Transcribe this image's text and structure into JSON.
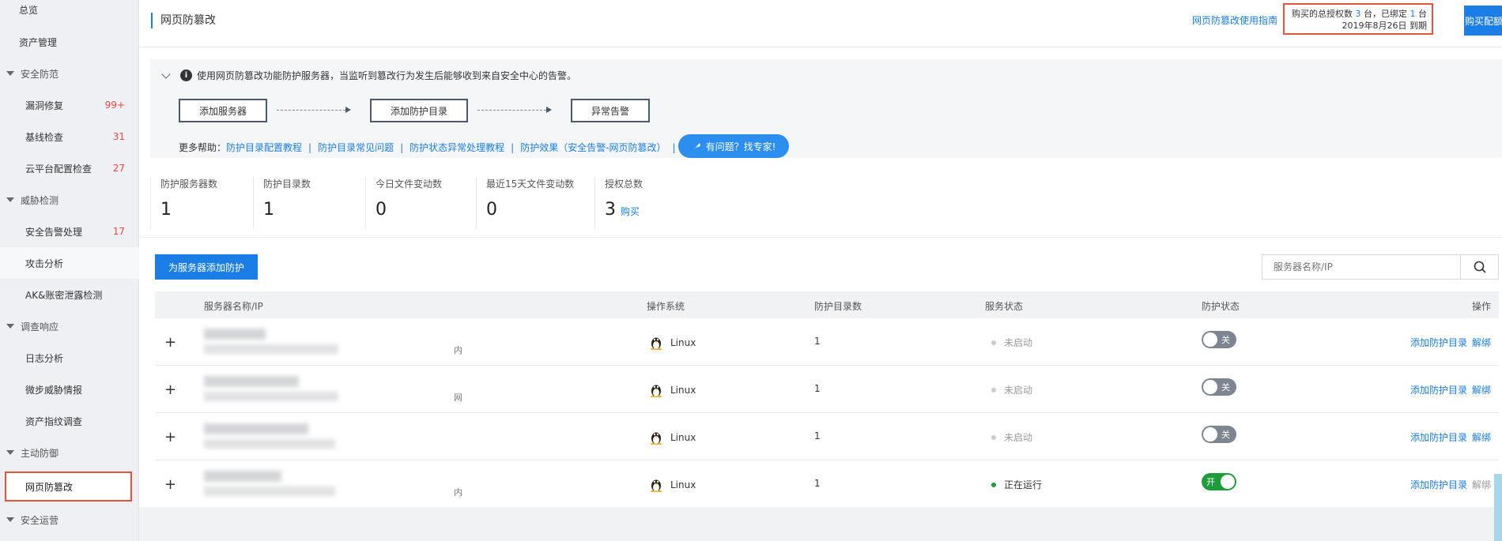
{
  "sidebar": {
    "overview": "总览",
    "asset_mgmt": "资产管理",
    "groups": [
      {
        "label": "安全防范",
        "items": [
          {
            "label": "漏洞修复",
            "count": "99+"
          },
          {
            "label": "基线检查",
            "count": "31"
          },
          {
            "label": "云平台配置检查",
            "count": "27"
          }
        ]
      },
      {
        "label": "威胁检测",
        "items": [
          {
            "label": "安全告警处理",
            "count": "17"
          },
          {
            "label": "攻击分析",
            "count": ""
          },
          {
            "label": "AK&账密泄露检测",
            "count": ""
          }
        ]
      },
      {
        "label": "调查响应",
        "items": [
          {
            "label": "日志分析",
            "count": ""
          },
          {
            "label": "微步威胁情报",
            "count": ""
          },
          {
            "label": "资产指纹调查",
            "count": ""
          }
        ]
      },
      {
        "label": "主动防御",
        "items": [
          {
            "label": "网页防篡改",
            "count": ""
          }
        ]
      },
      {
        "label": "安全运营",
        "items": []
      }
    ]
  },
  "header": {
    "title": "网页防篡改",
    "guide_link": "网页防篡改使用指南",
    "license_prefix": "购买的总授权数",
    "license_total": "3",
    "license_mid": "台，已绑定",
    "license_bound": "1",
    "license_unit": "台",
    "expire": "2019年8月26日 到期",
    "buy_button": "购买配额"
  },
  "info": {
    "tip": "使用网页防篡改功能防护服务器，当监听到篡改行为发生后能够收到来自安全中心的告警。",
    "steps": [
      "添加服务器",
      "添加防护目录",
      "异常告警"
    ],
    "help_label": "更多帮助：",
    "help_links": [
      "防护目录配置教程",
      "防护目录常见问题",
      "防护状态异常处理教程",
      "防护效果（安全告警-网页防篡改）"
    ],
    "expert_button": "有问题？找专家!"
  },
  "stats": [
    {
      "label": "防护服务器数",
      "value": "1"
    },
    {
      "label": "防护目录数",
      "value": "1"
    },
    {
      "label": "今日文件变动数",
      "value": "0"
    },
    {
      "label": "最近15天文件变动数",
      "value": "0"
    },
    {
      "label": "授权总数",
      "value": "3",
      "extra": "购买"
    }
  ],
  "toolbar": {
    "add_button": "为服务器添加防护",
    "search_placeholder": "服务器名称/IP"
  },
  "table": {
    "columns": [
      "服务器名称/IP",
      "操作系统",
      "防护目录数",
      "服务状态",
      "防护状态",
      "操作"
    ],
    "rows": [
      {
        "suffix": "内",
        "os": "Linux",
        "dirs": "1",
        "status": "未启动",
        "status_color": "#cccccc",
        "toggle": "关",
        "on": false,
        "op_add": "添加防护目录",
        "op_unbind": "解绑"
      },
      {
        "suffix": "网",
        "os": "Linux",
        "dirs": "1",
        "status": "未启动",
        "status_color": "#cccccc",
        "toggle": "关",
        "on": false,
        "op_add": "添加防护目录",
        "op_unbind": "解绑"
      },
      {
        "suffix": "",
        "os": "Linux",
        "dirs": "1",
        "status": "未启动",
        "status_color": "#cccccc",
        "toggle": "关",
        "on": false,
        "op_add": "添加防护目录",
        "op_unbind": "解绑"
      },
      {
        "suffix": "内",
        "os": "Linux",
        "dirs": "1",
        "status": "正在运行",
        "status_color": "#1e9c3a",
        "toggle": "开",
        "on": true,
        "op_add": "添加防护目录",
        "op_unbind": "解绑"
      }
    ]
  },
  "colors": {
    "accent": "#1a7ee6",
    "highlight_border": "#e8523a",
    "danger": "#e84545",
    "running": "#1e9c3a"
  }
}
